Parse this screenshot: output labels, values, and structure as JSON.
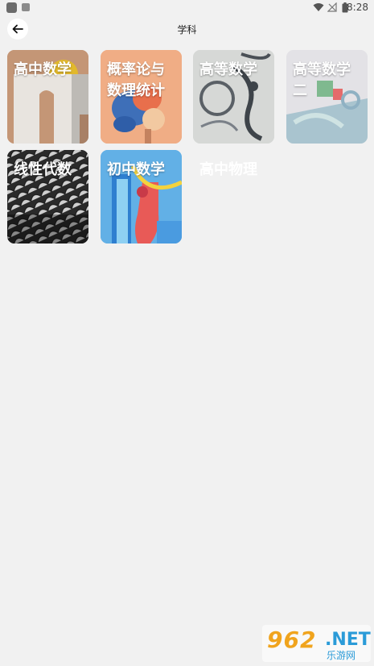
{
  "status_bar": {
    "time": "8:28"
  },
  "header": {
    "title": "学科",
    "back_icon": "arrow-left-icon"
  },
  "subjects": [
    {
      "label": "高中数学"
    },
    {
      "label": "概率论与数理统计"
    },
    {
      "label": "高等数学"
    },
    {
      "label": "高等数学二"
    },
    {
      "label": "线性代数"
    },
    {
      "label": "初中数学"
    },
    {
      "label": "高中物理"
    }
  ],
  "watermark": {
    "brand": "962",
    "net": ".NET",
    "subtitle": "乐游网"
  },
  "colors": {
    "background": "#f1f1f1",
    "text": "#ffffff"
  }
}
